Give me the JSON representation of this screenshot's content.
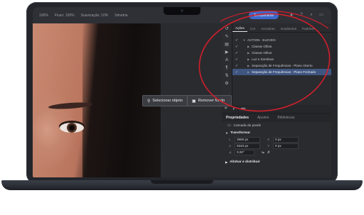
{
  "options_bar": {
    "items": [
      "100%",
      "Fluxo: 100%",
      "Suavização: 10%",
      "Simetria"
    ]
  },
  "share_button": "Compartilhar",
  "context_toolbar": {
    "select_subject": "Selecionar objeto",
    "remove_background": "Remover fundo"
  },
  "actions_panel": {
    "tabs": [
      "Ações",
      "Cor",
      "Amostras",
      "Gradientes",
      "Padrões"
    ],
    "rows": [
      {
        "label": "ACTION - ELEVEN",
        "selected": false
      },
      {
        "label": "Clarear Olhos",
        "selected": false
      },
      {
        "label": "Clarear Olhos",
        "selected": false
      },
      {
        "label": "Luz e Sombras",
        "selected": false
      },
      {
        "label": "Separação de Frequências - Plano Aberto",
        "selected": false
      },
      {
        "label": "Separação de Frequências - Plano Fechado",
        "selected": true
      }
    ]
  },
  "properties_panel": {
    "tabs": [
      "Propriedades",
      "Ajustes",
      "Bibliotecas"
    ],
    "layer_type": "Camada de pixels",
    "transform_section": "Transformar",
    "width_label": "L",
    "width_value": "3960 px",
    "x_label": "X",
    "x_value": "0 px",
    "height_label": "A",
    "height_value": "5343 px",
    "y_label": "Y",
    "y_value": "0 px",
    "angle_value": "0,00°",
    "align_section": "Alinhar e distribuir"
  },
  "colors": {
    "annotation_red": "#d11f2b",
    "selection_blue": "#3f5681",
    "share_blue": "#3d69c9"
  }
}
